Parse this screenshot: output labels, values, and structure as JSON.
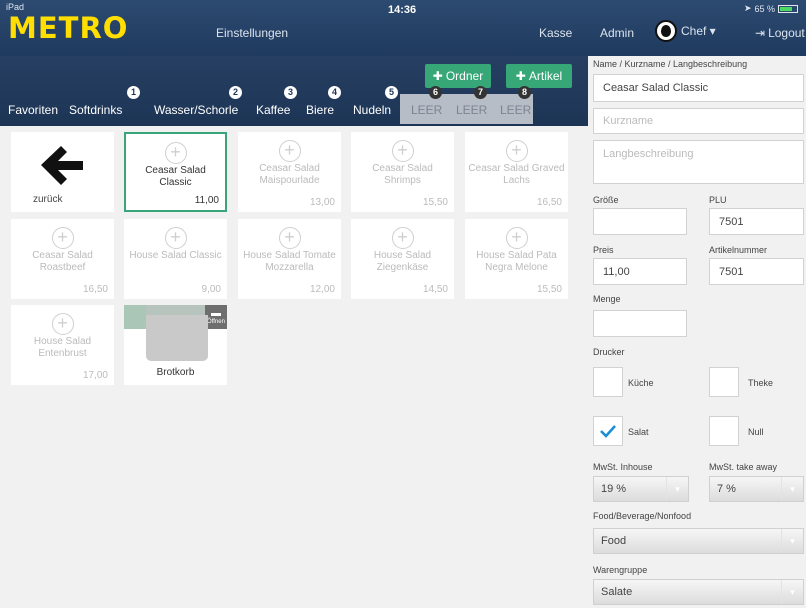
{
  "statusbar": {
    "device": "iPad",
    "time": "14:36",
    "battery": "65 %"
  },
  "header": {
    "logo": "METRO",
    "nav": {
      "settings": "Einstellungen",
      "kasse": "Kasse",
      "admin": "Admin",
      "user": "Chef ▾",
      "logout": "Logout"
    }
  },
  "toolbar": {
    "ordner": "Ordner",
    "artikel": "Artikel"
  },
  "categories": [
    {
      "label": "Favoriten",
      "num": ""
    },
    {
      "label": "Softdrinks",
      "num": "1"
    },
    {
      "label": "Wasser/Schorle",
      "num": "2"
    },
    {
      "label": "Kaffee",
      "num": "3"
    },
    {
      "label": "Biere",
      "num": "4"
    },
    {
      "label": "Nudeln",
      "num": "5"
    },
    {
      "label": "LEER",
      "num": "6"
    },
    {
      "label": "LEER",
      "num": "7"
    },
    {
      "label": "LEER",
      "num": "8"
    }
  ],
  "tiles": [
    {
      "name": "zurück",
      "price": ""
    },
    {
      "name": "Ceasar Salad Classic",
      "price": "11,00"
    },
    {
      "name": "Ceasar Salad Maispourlade",
      "price": "13,00"
    },
    {
      "name": "Ceasar Salad Shrimps",
      "price": "15,50"
    },
    {
      "name": "Ceasar Salad Graved Lachs",
      "price": "16,50"
    },
    {
      "name": "Ceasar Salad Roastbeef",
      "price": "16,50"
    },
    {
      "name": "House Salad Classic",
      "price": "9,00"
    },
    {
      "name": "House Salad Tomate Mozzarella",
      "price": "12,00"
    },
    {
      "name": "House Salad Ziegenkäse",
      "price": "14,50"
    },
    {
      "name": "House Salad Pata Negra Melone",
      "price": "15,50"
    },
    {
      "name": "House Salad Entenbrust",
      "price": "17,00"
    },
    {
      "name": "Brotkorb",
      "price": "",
      "open_label": "Öffnen"
    }
  ],
  "form": {
    "name_label": "Name / Kurzname / Langbeschreibung",
    "name_value": "Ceasar Salad Classic",
    "kurzname_placeholder": "Kurzname",
    "langbeschreibung_placeholder": "Langbeschreibung",
    "groesse_label": "Größe",
    "groesse_value": "",
    "plu_label": "PLU",
    "plu_value": "7501",
    "preis_label": "Preis",
    "preis_value": "11,00",
    "artikelnummer_label": "Artikelnummer",
    "artikelnummer_value": "7501",
    "menge_label": "Menge",
    "menge_value": "",
    "drucker_label": "Drucker",
    "drucker": [
      {
        "label": "Küche",
        "checked": false
      },
      {
        "label": "Theke",
        "checked": false
      },
      {
        "label": "Salat",
        "checked": true
      },
      {
        "label": "Null",
        "checked": false
      }
    ],
    "mwst_inhouse_label": "MwSt. Inhouse",
    "mwst_inhouse_value": "19 %",
    "mwst_takeaway_label": "MwSt. take away",
    "mwst_takeaway_value": "7 %",
    "fbn_label": "Food/Beverage/Nonfood",
    "fbn_value": "Food",
    "warengruppe_label": "Warengruppe",
    "warengruppe_value": "Salate"
  },
  "colors": {
    "header": "#1f3a5f",
    "accent": "#37a778",
    "logo": "#ffde00",
    "check": "#1a8fd8"
  }
}
